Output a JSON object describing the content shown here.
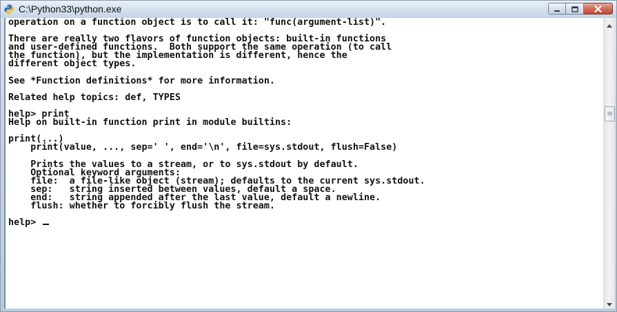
{
  "window": {
    "title": "C:\\Python33\\python.exe",
    "icon": "python-icon"
  },
  "caption_buttons": {
    "minimize_icon": "minimize-icon",
    "maximize_icon": "maximize-icon",
    "close_icon": "close-icon"
  },
  "console": {
    "lines": [
      "operation on a function object is to call it: \"func(argument-list)\".",
      "",
      "There are really two flavors of function objects: built-in functions",
      "and user-defined functions.  Both support the same operation (to call",
      "the function), but the implementation is different, hence the",
      "different object types.",
      "",
      "See *Function definitions* for more information.",
      "",
      "Related help topics: def, TYPES",
      "",
      "help> print",
      "Help on built-in function print in module builtins:",
      "",
      "print(...)",
      "    print(value, ..., sep=' ', end='\\n', file=sys.stdout, flush=False)",
      "",
      "    Prints the values to a stream, or to sys.stdout by default.",
      "    Optional keyword arguments:",
      "    file:  a file-like object (stream); defaults to the current sys.stdout.",
      "    sep:   string inserted between values, default a space.",
      "    end:   string appended after the last value, default a newline.",
      "    flush: whether to forcibly flush the stream.",
      ""
    ],
    "prompt": "help> "
  },
  "scrollbar": {
    "up_icon": "scroll-up-arrow-icon",
    "down_icon": "scroll-down-arrow-icon"
  }
}
